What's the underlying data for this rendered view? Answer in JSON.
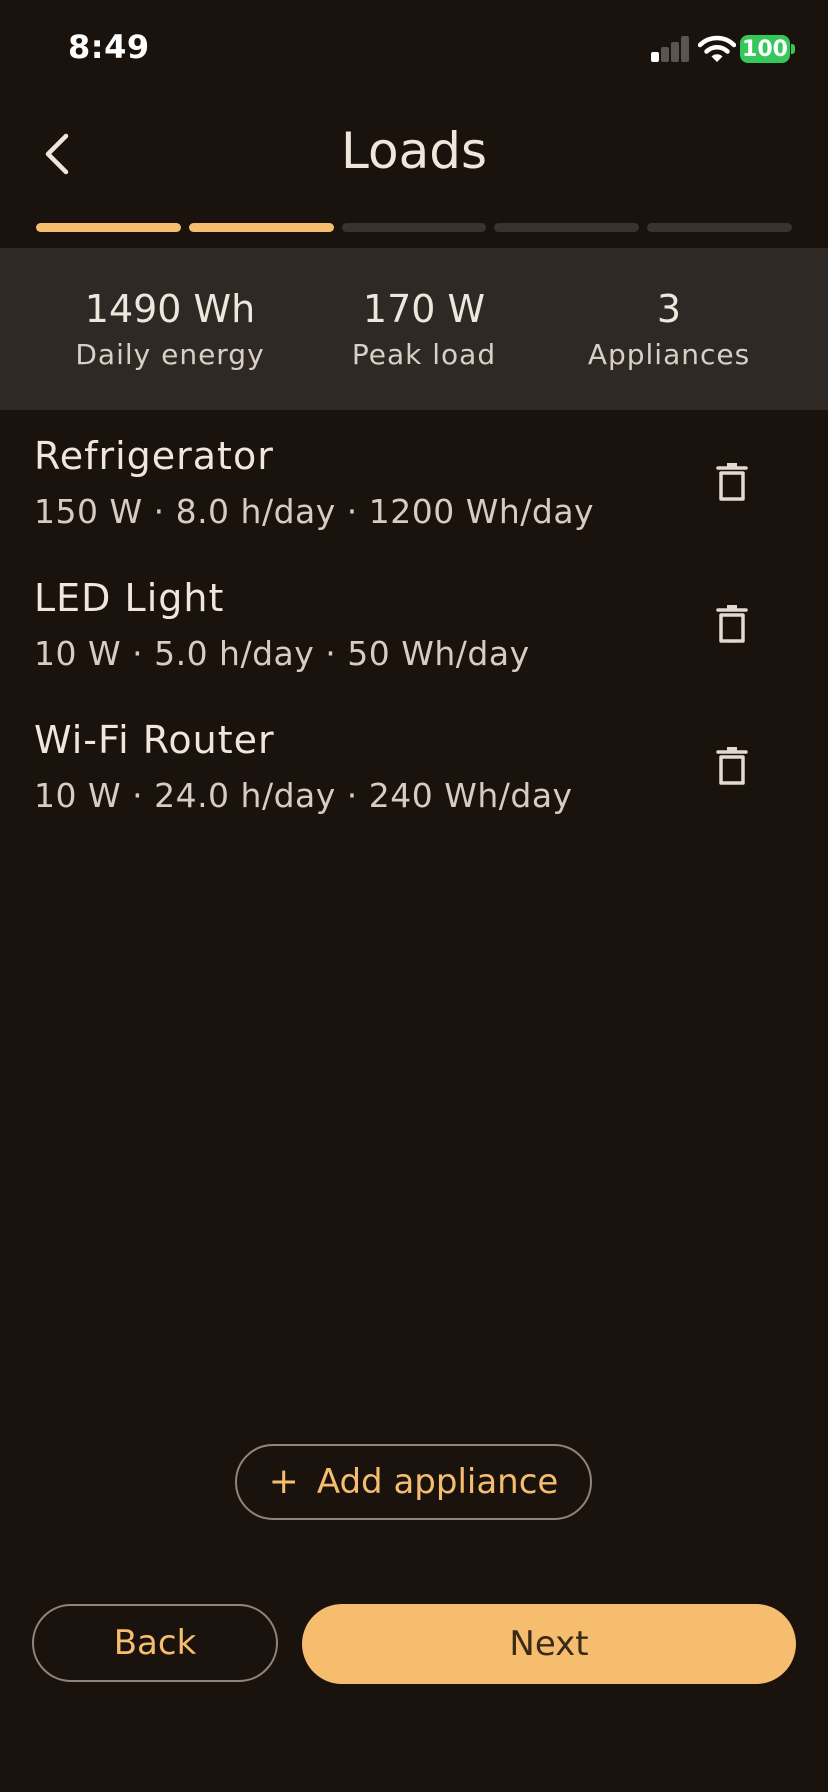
{
  "status_bar": {
    "time": "8:49",
    "battery": "100",
    "icons": [
      "signal-icon",
      "wifi-icon",
      "battery-icon"
    ]
  },
  "header": {
    "title": "Loads",
    "back_icon": "chevron-left-icon"
  },
  "progress": {
    "total_steps": 5,
    "completed_steps": 2,
    "active_color": "#f6bd6f",
    "inactive_color": "#3a332d"
  },
  "summary": {
    "daily_energy": {
      "value": "1490 Wh",
      "label": "Daily energy"
    },
    "peak_load": {
      "value": "170 W",
      "label": "Peak load"
    },
    "appliances": {
      "value": "3",
      "label": "Appliances"
    }
  },
  "appliances": [
    {
      "name": "Refrigerator",
      "detail": "150 W · 8.0 h/day · 1200 Wh/day",
      "delete_icon": "trash-icon"
    },
    {
      "name": "LED Light",
      "detail": "10 W · 5.0 h/day · 50 Wh/day",
      "delete_icon": "trash-icon"
    },
    {
      "name": "Wi-Fi Router",
      "detail": "10 W · 24.0 h/day · 240 Wh/day",
      "delete_icon": "trash-icon"
    }
  ],
  "actions": {
    "add_symbol": "+",
    "add_label": "Add appliance",
    "back_label": "Back",
    "next_label": "Next"
  },
  "colors": {
    "background": "#19120d",
    "summary_background": "#2f2925",
    "accent": "#f6bd6f",
    "battery_green": "#34c759"
  }
}
